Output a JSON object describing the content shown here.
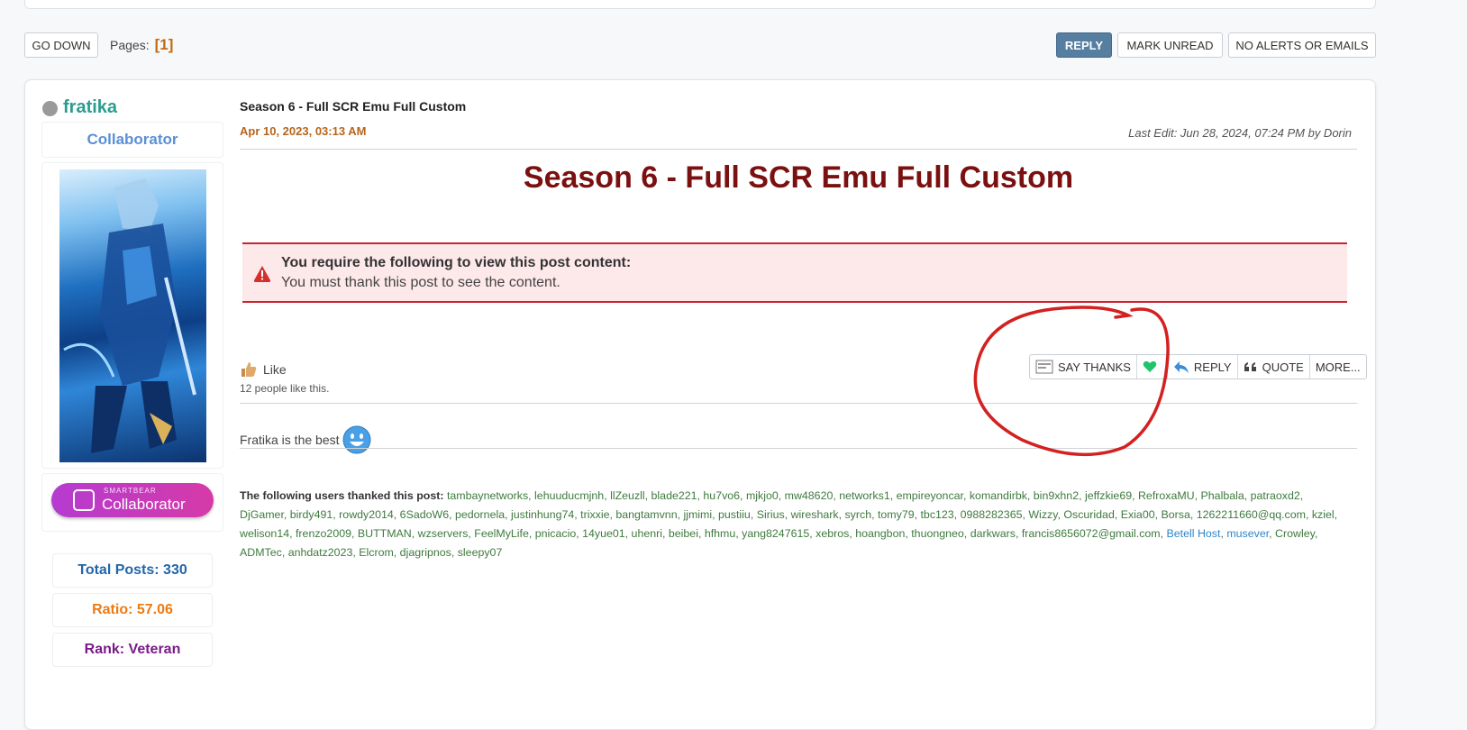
{
  "nav": {
    "go_down": "GO DOWN",
    "pages_label": "Pages:",
    "current_page": "[1]",
    "reply": "REPLY",
    "mark_unread": "MARK UNREAD",
    "no_alerts": "NO ALERTS OR EMAILS"
  },
  "poster": {
    "name": "fratika",
    "group": "Collaborator",
    "badge_small": "SMARTBEAR",
    "badge_text": "Collaborator",
    "total_posts": "Total Posts: 330",
    "ratio": "Ratio: 57.06",
    "rank": "Rank: Veteran"
  },
  "post": {
    "subject": "Season 6 - Full SCR Emu Full Custom",
    "date": "Apr 10, 2023, 03:13 AM",
    "last_edit": "Last Edit: Jun 28, 2024, 07:24 PM by Dorin",
    "title": "Season 6 - Full SCR Emu Full Custom",
    "notice_head": "You require the following to view this post content:",
    "notice_body": "You must thank this post to see the content.",
    "like_label": "Like",
    "like_count": "12 people like this.",
    "signature": "Fratika is the best"
  },
  "actions": {
    "say_thanks": "SAY THANKS",
    "reply": "REPLY",
    "quote": "QUOTE",
    "more": "MORE..."
  },
  "thanks": {
    "label": "The following users thanked this post:",
    "users_a": "tambaynetworks, lehuuducmjnh, llZeuzll, blade221, hu7vo6, mjkjo0, mw48620, networks1, empireyoncar, komandirbk, bin9xhn2, jeffzkie69, RefroxaMU, Phalbala, patraoxd2, DjGamer, birdy491, rowdy2014, 6SadoW6, pedornela, justinhung74, trixxie, bangtamvnn, jjmimi, pustiiu, Sirius, wireshark, syrch, tomy79, tbc123, 0988282365, Wizzy, Oscuridad, Exia00, Borsa, 1262211660@qq.com, kziel, welison14, frenzo2009, BUTTMAN, wzservers, FeelMyLife, pnicacio, 14yue01, uhenri, beibei, hfhmu, yang8247615, xebros, hoangbon, thuongneo, darkwars, francis8656072@gmail.com,",
    "user_betell": "Betell Host",
    "user_musever": "musever",
    "users_b": ", Crowley, ADMTec, anhdatz2023, Elcrom, djagripnos, sleepy07"
  },
  "colors": {
    "accent": "#557ea0",
    "poster_name": "#2a9d8f",
    "title": "#7a1010",
    "annotation": "#d42020"
  }
}
